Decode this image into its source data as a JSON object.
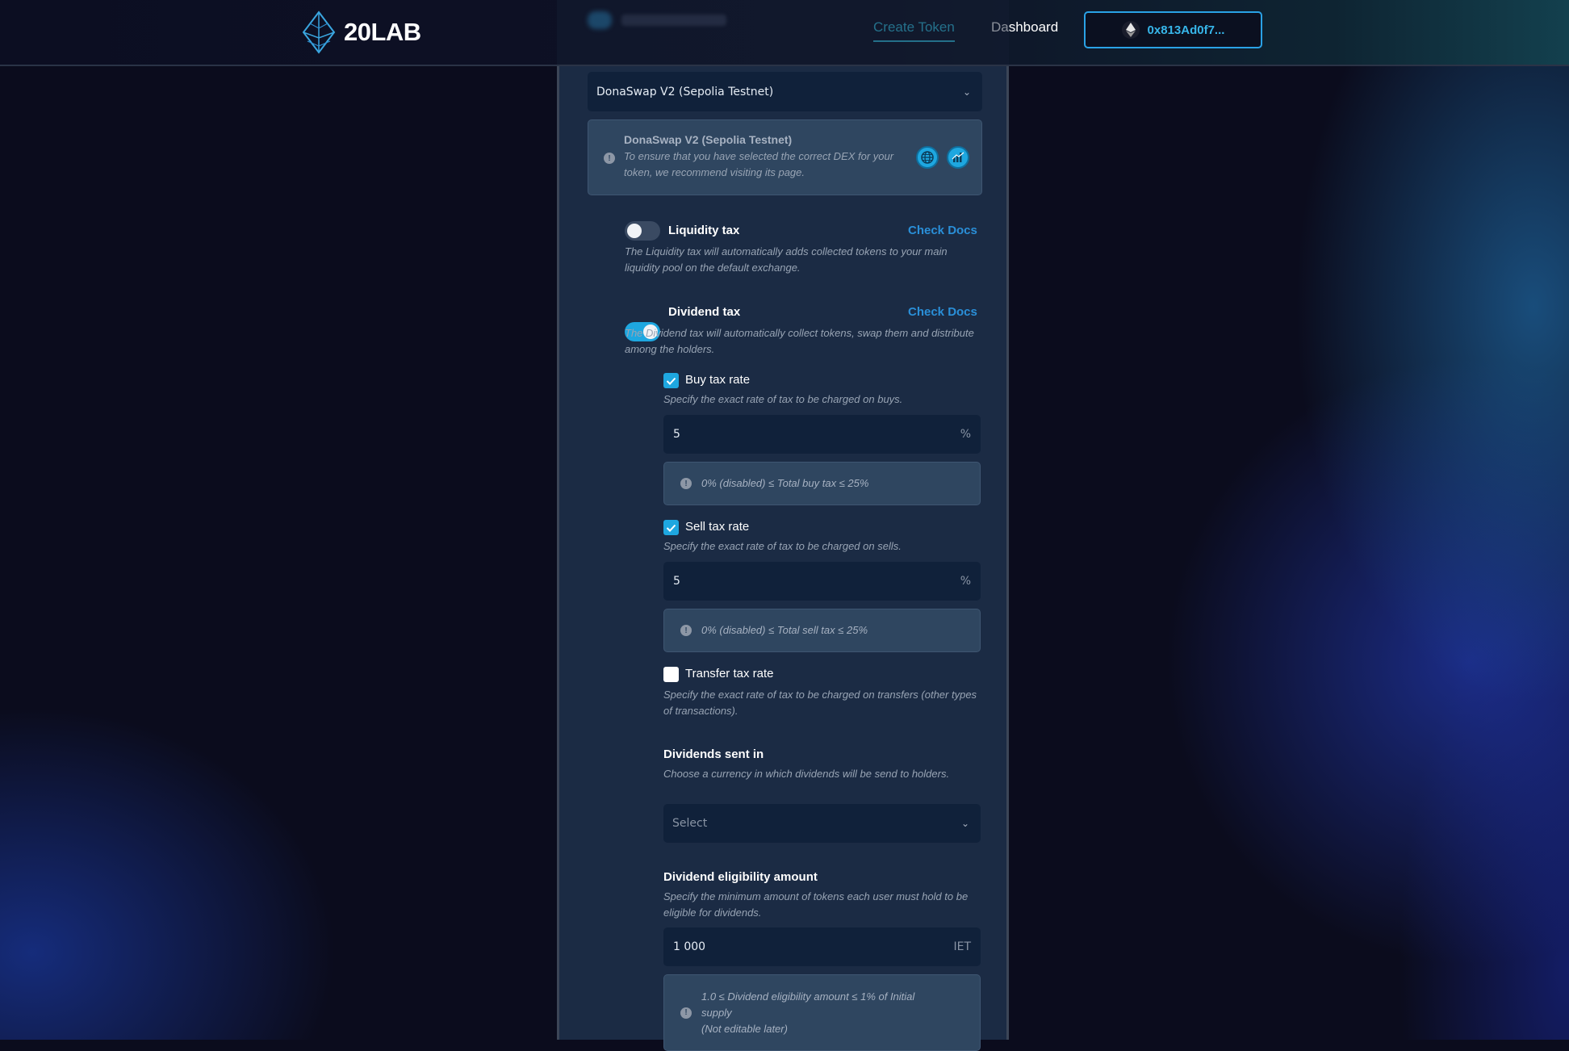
{
  "header": {
    "logo_text": "20LAB",
    "nav": {
      "create_token": "Create Token",
      "dashboard": "Dashboard"
    },
    "wallet_address": "0x813Ad0f7..."
  },
  "form": {
    "dex_select_value": "DonaSwap V2 (Sepolia Testnet)",
    "dex_info": {
      "title": "DonaSwap V2 (Sepolia Testnet)",
      "text": "To ensure that you have selected the correct DEX for your token, we recommend visiting its page."
    },
    "liquidity_tax": {
      "label": "Liquidity tax",
      "docs_link": "Check Docs",
      "description": "The Liquidity tax will automatically adds collected tokens to your main liquidity pool on the default exchange.",
      "enabled": false
    },
    "dividend_tax": {
      "label": "Dividend tax",
      "docs_link": "Check Docs",
      "description": "The Dividend tax will automatically collect tokens, swap them and distribute among the holders.",
      "enabled": true
    },
    "buy_tax": {
      "label": "Buy tax rate",
      "description": "Specify the exact rate of tax to be charged on buys.",
      "value": "5",
      "unit": "%",
      "hint": "0% (disabled) ≤ Total buy tax ≤ 25%",
      "checked": true
    },
    "sell_tax": {
      "label": "Sell tax rate",
      "description": "Specify the exact rate of tax to be charged on sells.",
      "value": "5",
      "unit": "%",
      "hint": "0% (disabled) ≤ Total sell tax ≤ 25%",
      "checked": true
    },
    "transfer_tax": {
      "label": "Transfer tax rate",
      "description": "Specify the exact rate of tax to be charged on transfers (other types of transactions).",
      "checked": false
    },
    "dividends_sent_in": {
      "title": "Dividends sent in",
      "description": "Choose a currency in which dividends will be send to holders.",
      "placeholder": "Select"
    },
    "dividend_eligibility": {
      "title": "Dividend eligibility amount",
      "description": "Specify the minimum amount of tokens each user must hold to be eligible for dividends.",
      "value": "1 000",
      "unit": "IET",
      "hint_line1": "1.0 ≤ Dividend eligibility amount ≤ 1% of Initial",
      "hint_line2": "supply",
      "hint_line3": "(Not editable later)"
    }
  },
  "colors": {
    "accent": "#1ea7e0",
    "link": "#2a8fd8",
    "panel": "#1b2b44",
    "input_bg": "#10213a",
    "hint_bg": "#2f4660"
  }
}
